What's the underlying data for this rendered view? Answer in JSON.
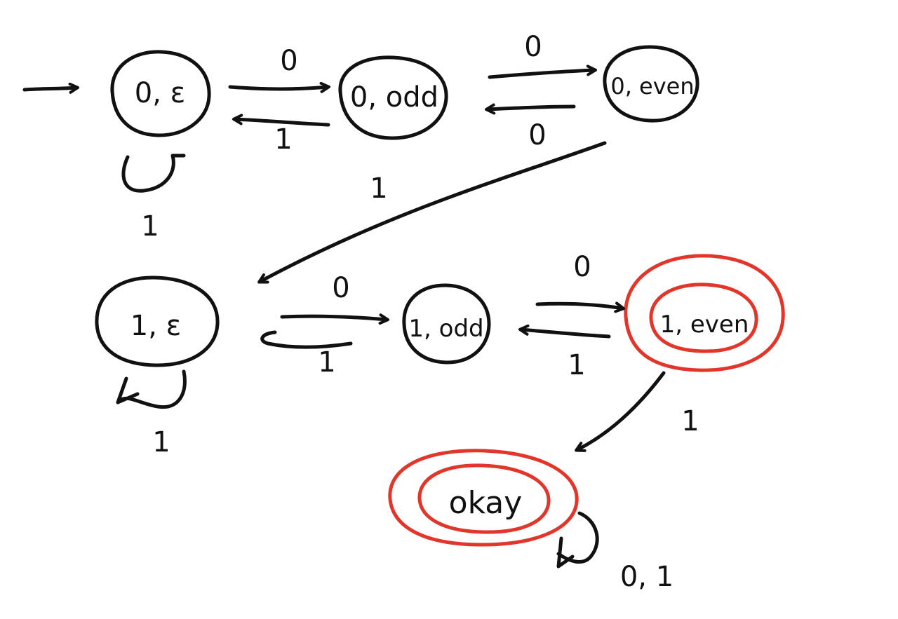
{
  "colors": {
    "ink": "#111111",
    "accept": "#e3362b"
  },
  "states": {
    "s0_eps": "0, ε",
    "s0_odd": "0, odd",
    "s0_even": "0, even",
    "s1_eps": "1, ε",
    "s1_odd": "1, odd",
    "s1_even": "1, even",
    "okay": "okay"
  },
  "accepting_states": [
    "1, even",
    "okay"
  ],
  "transitions": [
    {
      "from": "start",
      "to": "0, ε",
      "label": ""
    },
    {
      "from": "0, ε",
      "to": "0, odd",
      "label": "0"
    },
    {
      "from": "0, odd",
      "to": "0, ε",
      "label": "1"
    },
    {
      "from": "0, odd",
      "to": "0, even",
      "label": "0"
    },
    {
      "from": "0, even",
      "to": "0, odd",
      "label": "0"
    },
    {
      "from": "0, ε",
      "to": "0, ε",
      "label": "1"
    },
    {
      "from": "0, odd",
      "to": "?",
      "label": "1"
    },
    {
      "from": "0, even",
      "to": "1, ε",
      "label": ""
    },
    {
      "from": "1, ε",
      "to": "1, odd",
      "label": "0"
    },
    {
      "from": "1, odd",
      "to": "1, ε",
      "label": "1"
    },
    {
      "from": "1, odd",
      "to": "1, even",
      "label": "0"
    },
    {
      "from": "1, even",
      "to": "1, odd",
      "label": "1"
    },
    {
      "from": "1, ε",
      "to": "1, ε",
      "label": "1"
    },
    {
      "from": "1, even",
      "to": "okay",
      "label": "1"
    },
    {
      "from": "okay",
      "to": "okay",
      "label": "0, 1"
    }
  ],
  "labels": {
    "t_0e_0o": "0",
    "t_0o_0e": "1",
    "t_0o_0ev": "0",
    "t_0ev_0o": "0",
    "t_0e_self": "1",
    "t_0o_1": "1",
    "t_1e_1o": "0",
    "t_1o_1e": "1",
    "t_1o_1ev": "0",
    "t_1ev_1o": "1",
    "t_1e_self": "1",
    "t_1ev_okay": "1",
    "t_okay_self": "0, 1"
  }
}
